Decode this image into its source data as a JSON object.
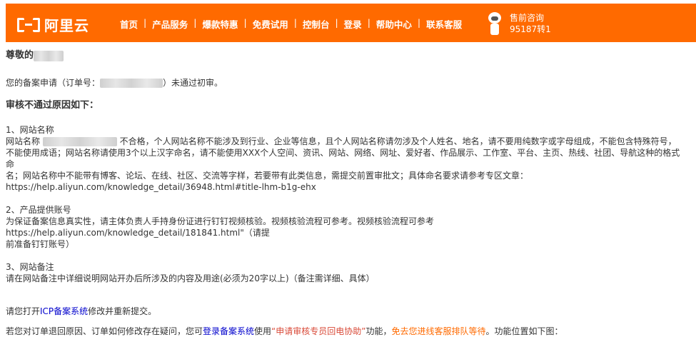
{
  "header": {
    "logo_text": "阿里云",
    "nav": [
      "首页",
      "产品服务",
      "爆款特惠",
      "免费试用",
      "控制台",
      "登录",
      "帮助中心",
      "联系客服"
    ],
    "separator": "|",
    "consult_title": "售前咨询",
    "consult_phone": "95187转1"
  },
  "email": {
    "greeting": "尊敬的",
    "notice_prefix": "您的备案申请（订单号：",
    "notice_suffix": "）未通过初审。",
    "reasons_title": "审核不通过原因如下：",
    "s1_title": "1、网站名称",
    "s1_label": "网站名称",
    "s1_text_a": "不合格，个人网站名称不能涉及到行业、企业等信息，且个人网站名称请勿涉及个人姓名、地名，请不要用纯数字或字母组成，不能包含特殊符号，",
    "s1_text_b": "不能使用成语；网站名称请使用3个以上汉字命名，请不能使用XXX个人空间、资讯、网站、网络、网址、爱好者、作品展示、工作室、平台、主页、热线、社团、导航这种的格式命",
    "s1_text_c": "名；网站名称中不能带有博客、论坛、在线、社区、交流等字样，若要带有此类信息，需提交前置审批文；具体命名要求请参考专区文章：",
    "s1_link": "https://help.aliyun.com/knowledge_detail/36948.html#title-lhm-b1g-ehx",
    "s2_title": "2、产品提供账号",
    "s2_text_a": "为保证备案信息真实性，请主体负责人手持身份证进行钉钉视频核验。视频核验流程可参考。视频核验流程可参考https://help.aliyun.com/knowledge_detail/181841.html\"（请提",
    "s2_text_b": "前准备钉钉账号）",
    "s3_title": "3、网站备注",
    "s3_text": "请在网站备注中详细说明网站开办后所涉及的内容及用途(必须为20字以上)（备注需详细、具体）",
    "open_prefix": "请您打开",
    "open_link": "ICP备案系统",
    "open_suffix": "修改并重新提交。",
    "final_a": "若您对订单退回原因、订单如何修改存在疑问，您可",
    "final_link": "登录备案系统",
    "final_b": "使用",
    "final_red": "“申请审核专员回电协助”",
    "final_c": "功能，",
    "final_orange": "免去您进线客服排队等待",
    "final_d": "。功能位置如下图："
  }
}
